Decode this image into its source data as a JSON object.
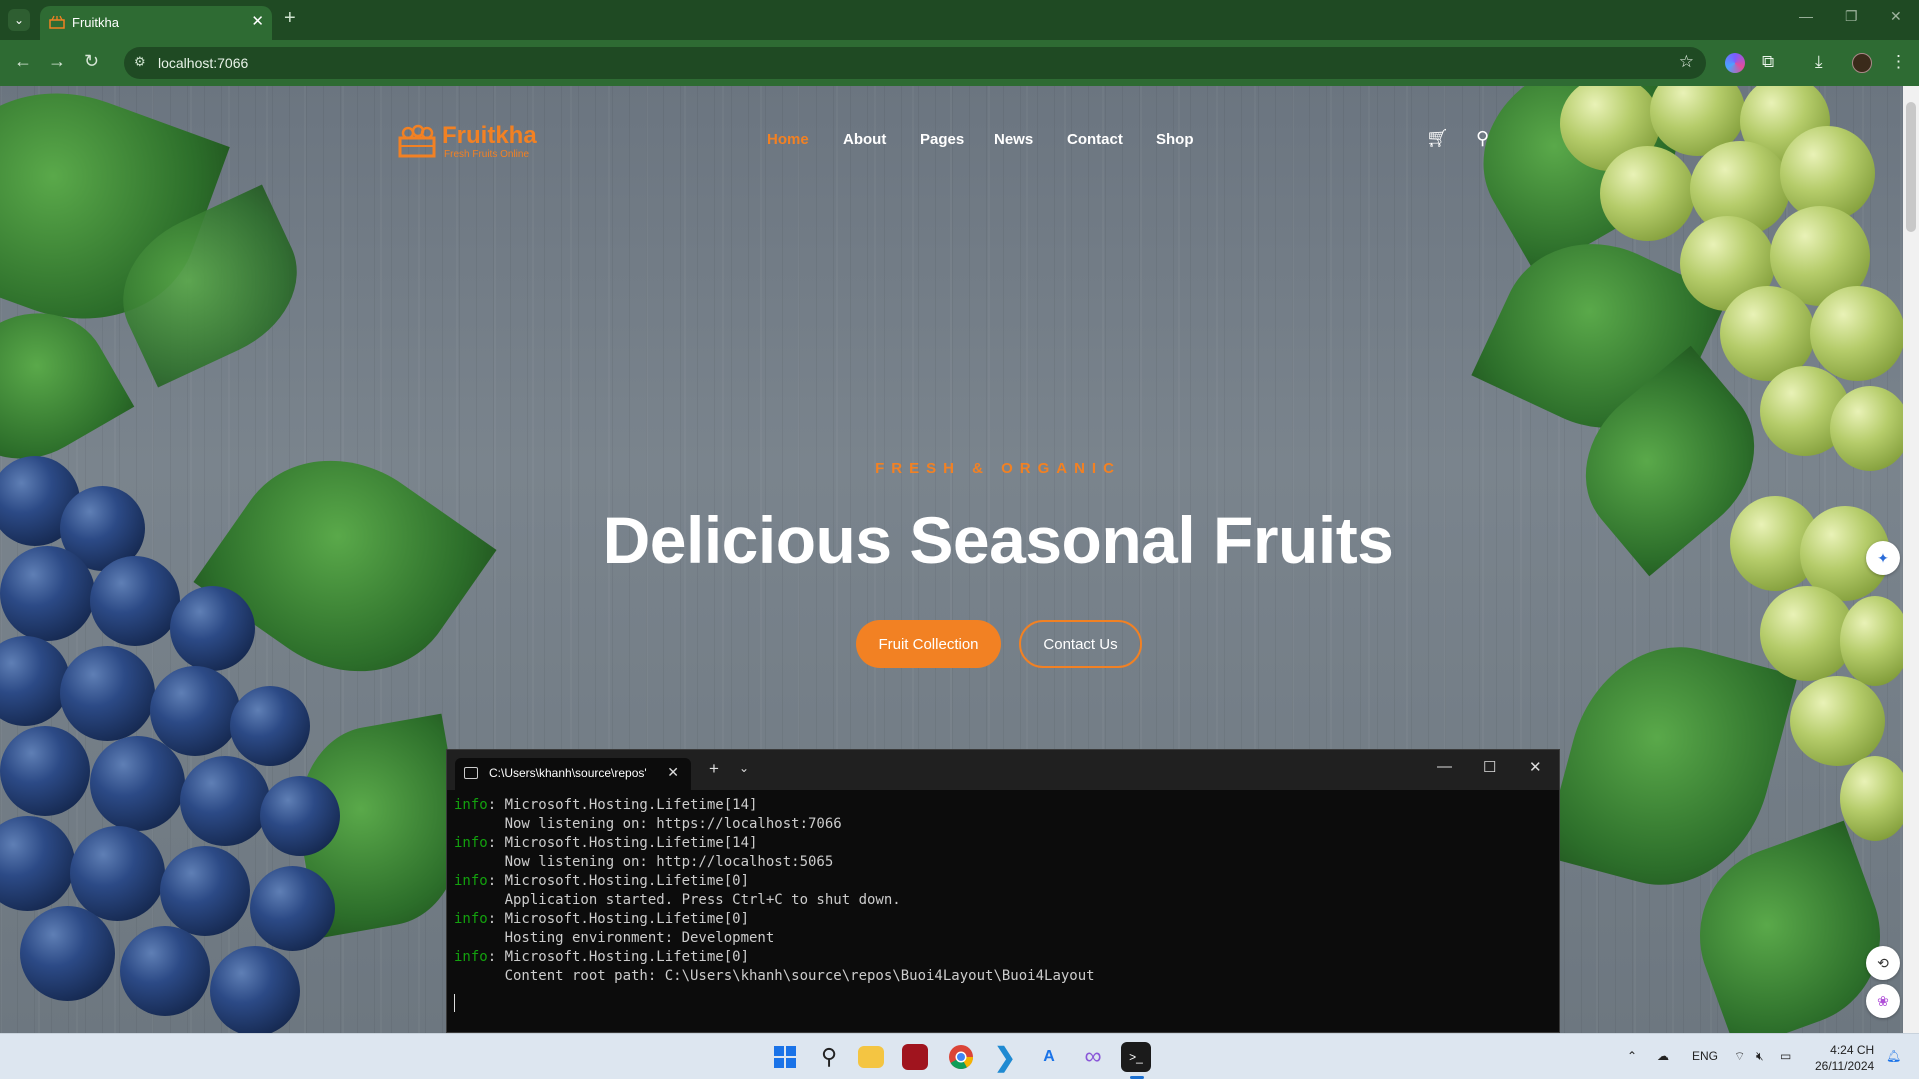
{
  "browser": {
    "tab_title": "Fruitkha",
    "url": "localhost:7066",
    "nav_icons": {
      "back": "back-arrow-icon",
      "forward": "forward-arrow-icon",
      "reload": "reload-icon"
    },
    "toolbar_icons": [
      "bookmark-star-icon",
      "extension-puzzle-icon",
      "download-icon",
      "menu-dots-icon"
    ]
  },
  "site": {
    "logo_name": "Fruitkha",
    "logo_tagline": "Fresh Fruits Online",
    "nav": [
      {
        "label": "Home",
        "active": true
      },
      {
        "label": "About",
        "active": false
      },
      {
        "label": "Pages",
        "active": false
      },
      {
        "label": "News",
        "active": false
      },
      {
        "label": "Contact",
        "active": false
      },
      {
        "label": "Shop",
        "active": false
      }
    ],
    "icons": [
      "cart-icon",
      "search-icon"
    ]
  },
  "hero": {
    "eyebrow": "FRESH & ORGANIC",
    "title": "Delicious Seasonal Fruits",
    "primary_button": "Fruit Collection",
    "secondary_button": "Contact Us"
  },
  "terminal": {
    "tab_title": "C:\\Users\\khanh\\source\\repos'",
    "lines": [
      {
        "prefix": "info",
        "text": ": Microsoft.Hosting.Lifetime[14]"
      },
      {
        "prefix": "",
        "text": "      Now listening on: https://localhost:7066"
      },
      {
        "prefix": "info",
        "text": ": Microsoft.Hosting.Lifetime[14]"
      },
      {
        "prefix": "",
        "text": "      Now listening on: http://localhost:5065"
      },
      {
        "prefix": "info",
        "text": ": Microsoft.Hosting.Lifetime[0]"
      },
      {
        "prefix": "",
        "text": "      Application started. Press Ctrl+C to shut down."
      },
      {
        "prefix": "info",
        "text": ": Microsoft.Hosting.Lifetime[0]"
      },
      {
        "prefix": "",
        "text": "      Hosting environment: Development"
      },
      {
        "prefix": "info",
        "text": ": Microsoft.Hosting.Lifetime[0]"
      },
      {
        "prefix": "",
        "text": "      Content root path: C:\\Users\\khanh\\source\\repos\\Buoi4Layout\\Buoi4Layout"
      }
    ]
  },
  "taskbar": {
    "apps": [
      "windows-start-icon",
      "search-icon",
      "file-explorer-icon",
      "app-red-icon",
      "chrome-icon",
      "vscode-icon",
      "app-a-icon",
      "visual-studio-icon",
      "terminal-icon"
    ],
    "language": "ENG",
    "time": "4:24 CH",
    "date": "26/11/2024"
  },
  "colors": {
    "accent": "#f28123",
    "browser_green": "#2e6b33",
    "terminal_info": "#13a10e"
  }
}
